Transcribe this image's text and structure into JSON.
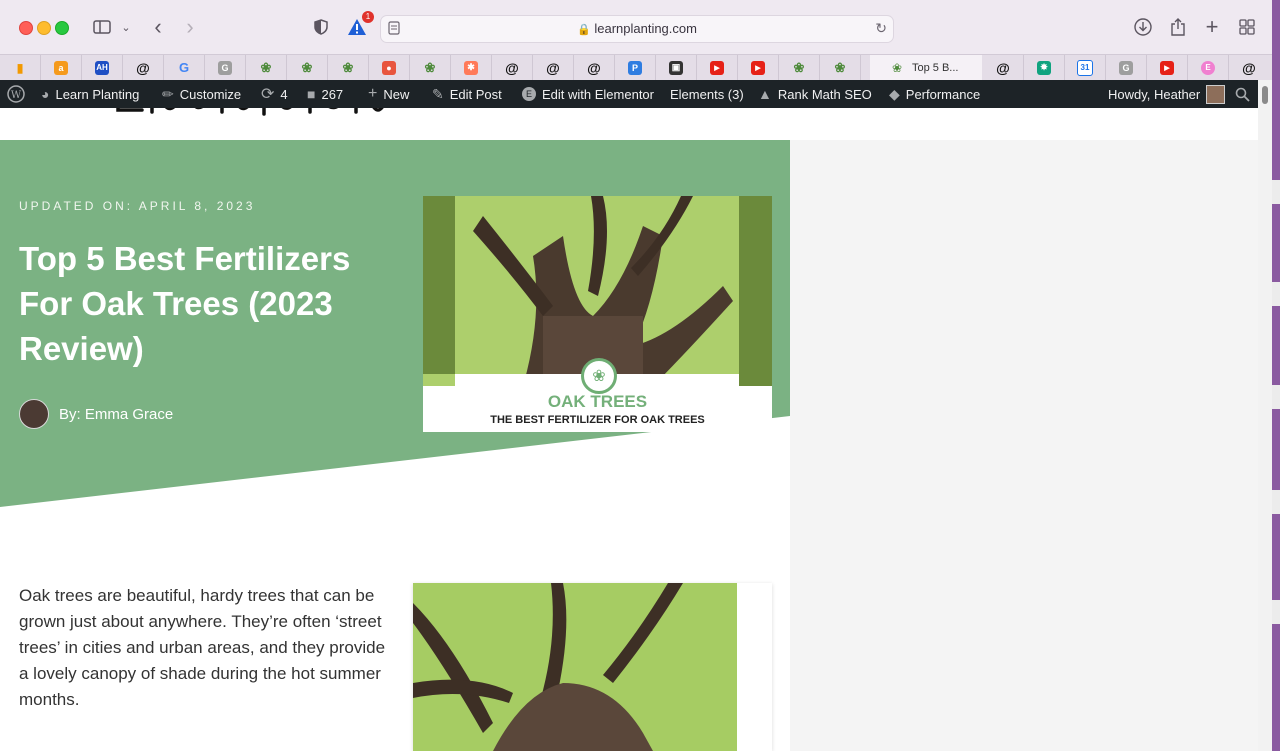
{
  "browser": {
    "url": "learnplanting.com",
    "notification_count": "1",
    "active_tab_title": "Top 5 B...",
    "tab_favicons": [
      "analytics-icon",
      "amazon-icon",
      "ahrefs-icon",
      "at-icon",
      "google-icon",
      "grammarly-icon",
      "plant-icon",
      "plant-icon",
      "plant-icon",
      "brand-icon",
      "plant-icon",
      "hubspot-icon",
      "at-icon",
      "at-icon",
      "at-icon",
      "pocket-icon",
      "calendar-icon",
      "youtube-icon",
      "youtube-icon",
      "plant-icon",
      "plant-icon"
    ],
    "right_tab_favicons": [
      "at-icon",
      "chatgpt-icon",
      "calendar31-icon",
      "grammarly-icon",
      "youtube-icon",
      "elementor-icon",
      "at-icon"
    ]
  },
  "wpbar": {
    "site": "Learn Planting",
    "customize": "Customize",
    "updates": "4",
    "comments": "267",
    "new": "New",
    "edit_post": "Edit Post",
    "elementor": "Edit with Elementor",
    "elements": "Elements (3)",
    "rankmath": "Rank Math SEO",
    "performance": "Performance",
    "howdy": "Howdy, Heather"
  },
  "article": {
    "updated": "UPDATED ON: APRIL 8, 2023",
    "title": "Top 5 Best Fertilizers For Oak Trees (2023 Review)",
    "author": "By: Emma Grace",
    "feature_title": "OAK TREES",
    "feature_subtitle": "THE BEST FERTILIZER FOR OAK TREES",
    "intro": "Oak trees are beautiful, hardy trees that can be grown just about anywhere. They’re often ‘street trees’ in cities and urban areas, and they provide a lovely canopy of shade during the hot summer months."
  },
  "colors": {
    "hero_green": "#7bb283",
    "accent_green": "#74b07a",
    "admin_bar": "#1d2327"
  }
}
